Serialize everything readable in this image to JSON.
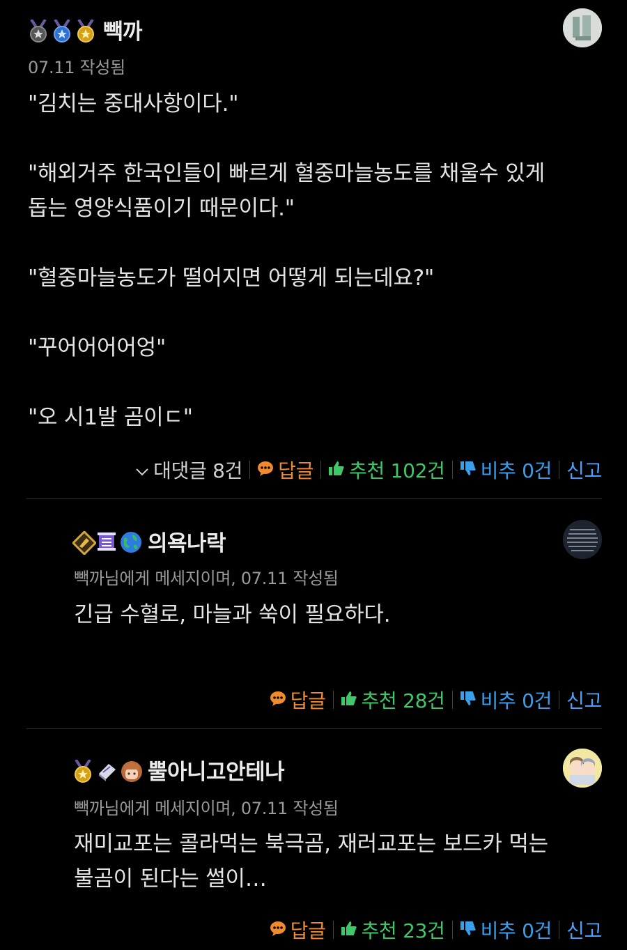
{
  "comments": [
    {
      "nickname": "빽까",
      "meta": "07.11 작성됨",
      "lines": [
        "\"김치는 중대사항이다.\"",
        "",
        "\"해외거주 한국인들이 빠르게 혈중마늘농도를 채울수 있게",
        "돕는 영양식품이기 때문이다.\"",
        "",
        "\"혈중마늘농도가 떨어지면 어떻게 되는데요?\"",
        "",
        "\"꾸어어어어엉\"",
        "",
        "\"오 시1발 곰이ㄷ\""
      ],
      "replies_label": "대댓글 8건",
      "reply_label": "답글",
      "recommend_label": "추천 102건",
      "dislike_label": "비추 0건",
      "report_label": "신고"
    },
    {
      "nickname": "의욕나락",
      "meta": "빽까님에게 메세지이며, 07.11 작성됨",
      "lines": [
        "긴급 수혈로, 마늘과 쑥이 필요하다."
      ],
      "reply_label": "답글",
      "recommend_label": "추천 28건",
      "dislike_label": "비추 0건",
      "report_label": "신고"
    },
    {
      "nickname": "뿔아니고안테나",
      "meta": "빽까님에게 메세지이며, 07.11 작성됨",
      "lines": [
        "재미교포는 콜라먹는 북극곰, 재러교포는 보드카 먹는",
        "불곰이 된다는 썰이…"
      ],
      "reply_label": "답글",
      "recommend_label": "추천 23건",
      "dislike_label": "비추 0건",
      "report_label": "신고"
    }
  ],
  "icons": {
    "medal": "medal-icon",
    "reply": "speech-bubble-icon",
    "recommend": "thumbs-up-icon",
    "dislike": "thumbs-down-icon",
    "replies": "chevron-down-icon"
  },
  "colors": {
    "background": "#000000",
    "reply": "#f08a2a",
    "recommend": "#3ec86a",
    "dislike": "#3a9ee8"
  }
}
